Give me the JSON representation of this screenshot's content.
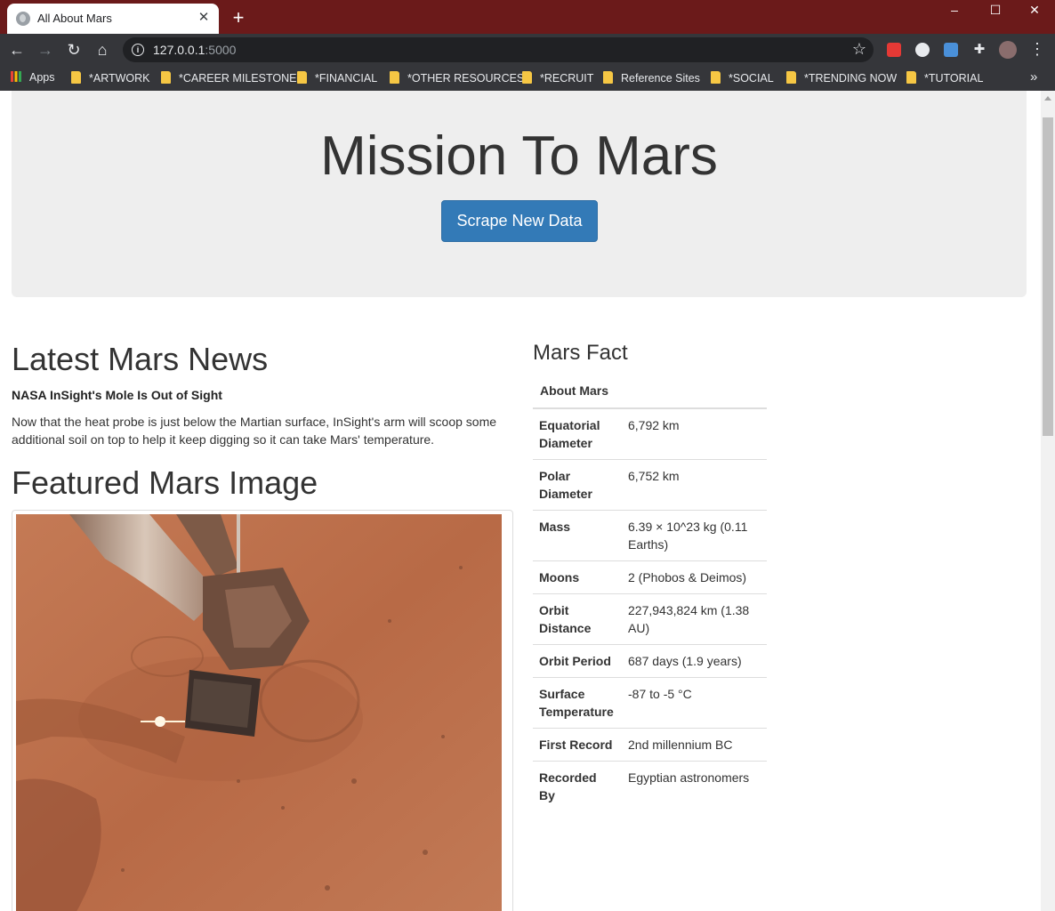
{
  "browser": {
    "tab_title": "All About Mars",
    "url_host": "127.0.0.1",
    "url_port": ":5000",
    "apps_label": "Apps",
    "bookmarks": [
      "*ARTWORK",
      "*CAREER MILESTONE",
      "*FINANCIAL",
      "*OTHER RESOURCES",
      "*RECRUIT",
      "Reference Sites",
      "*SOCIAL",
      "*TRENDING NOW",
      "*TUTORIAL"
    ],
    "chrome_color": "#6b1a1a"
  },
  "hero": {
    "title": "Mission To Mars",
    "button_label": "Scrape New Data",
    "button_color": "#337ab7"
  },
  "news": {
    "heading": "Latest Mars News",
    "title": "NASA InSight's Mole Is Out of Sight",
    "paragraph": "Now that the heat probe is just below the Martian surface, InSight's arm will scoop some additional soil on top to help it keep digging so it can take Mars' temperature."
  },
  "featured": {
    "heading": "Featured Mars Image"
  },
  "facts": {
    "heading": "Mars Fact",
    "table_header": "About Mars",
    "rows": [
      {
        "key": "Equatorial Diameter",
        "value": "6,792 km"
      },
      {
        "key": "Polar Diameter",
        "value": "6,752 km"
      },
      {
        "key": "Mass",
        "value": "6.39 × 10^23 kg (0.11 Earths)"
      },
      {
        "key": "Moons",
        "value": "2 (Phobos & Deimos)"
      },
      {
        "key": "Orbit Distance",
        "value": "227,943,824 km (1.38 AU)"
      },
      {
        "key": "Orbit Period",
        "value": "687 days (1.9 years)"
      },
      {
        "key": "Surface Temperature",
        "value": "-87 to -5 °C"
      },
      {
        "key": "First Record",
        "value": "2nd millennium BC"
      },
      {
        "key": "Recorded By",
        "value": "Egyptian astronomers"
      }
    ]
  }
}
